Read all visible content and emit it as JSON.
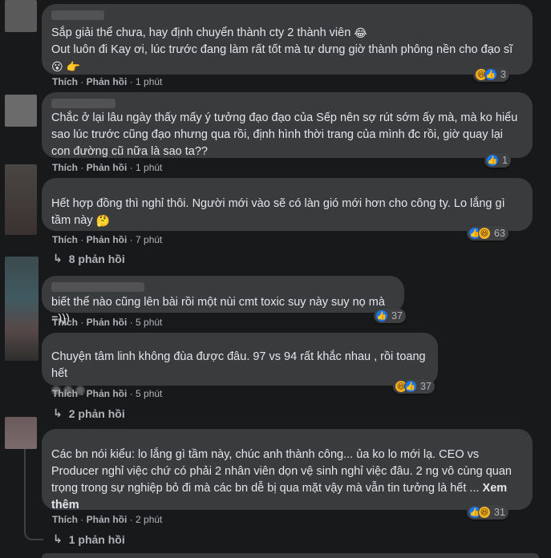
{
  "comments": [
    {
      "lines": [
        "Sắp giải thể chưa, hay định chuyển thành cty 2 thành viên",
        "Out luôn đi Kay ơi, lúc trước đang làm rất tốt mà tự dưng giờ thành phông nền cho đạo sĩ"
      ],
      "emoji1": "😂",
      "emoji2": "😮 👉",
      "like": "Thích",
      "reply": "Phản hồi",
      "time": "1 phút",
      "reaction_count": "3"
    },
    {
      "text": "Chắc ở lại lâu ngày thấy mấy ý tưởng đạo đạo của Sếp nên sợ rút sớm ấy mà, mà ko hiểu sao lúc trước cũng đạo nhưng qua rồi, định hình thời trang của mình đc rồi, giờ quay lại con đường cũ nữa là sao ta??",
      "like": "Thích",
      "reply": "Phản hồi",
      "time": "1 phút",
      "reaction_count": "1"
    },
    {
      "text": "Hết hợp đồng thì nghỉ thôi. Người mới vào sẽ có làn gió mới hơn cho công ty. Lo lắng gì tầm này",
      "emoji": "🤔",
      "like": "Thích",
      "reply": "Phản hồi",
      "time": "7 phút",
      "reaction_count": "63",
      "replies": "8 phản hồi"
    },
    {
      "text": "biết thể nào cũng lên bài rồi một nùi cmt toxic suy này suy nọ mà =)))",
      "like": "Thích",
      "reply": "Phản hồi",
      "time": "5 phút",
      "reaction_count": "37"
    },
    {
      "text": "Chuyện tâm linh không đùa được đâu. 97 vs 94 rất khắc nhau , rồi toang hết",
      "like": "Thích",
      "reply": "Phản hồi",
      "time": "5 phút",
      "reaction_count": "37",
      "replies": "2 phản hồi"
    },
    {
      "text": "Các bn nói kiểu: lo lắng gì tầm này, chúc anh thành công... ủa ko lo mới lạ. CEO vs Producer nghỉ việc chứ có phải 2 nhân viên dọn vệ sinh nghỉ việc đâu. 2 ng vô cùng quan trọng trong sự nghiệp bỏ đi mà các bn dễ bị qua mặt vậy mà vẫn tin tưởng là hết ...",
      "see_more": "Xem thêm",
      "like": "Thích",
      "reply": "Phản hồi",
      "time": "2 phút",
      "reaction_count": "31",
      "replies": "1 phản hồi"
    }
  ],
  "colors": {
    "bg": "#18191a",
    "bubble": "#3a3b3c",
    "like": "#1877f2",
    "haha": "#f7b125"
  }
}
